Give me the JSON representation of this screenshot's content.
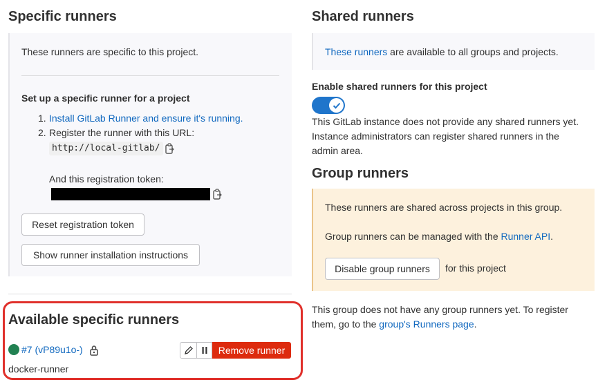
{
  "specific": {
    "title": "Specific runners",
    "intro": "These runners are specific to this project.",
    "setup_title": "Set up a specific runner for a project",
    "step1_num": "1.",
    "step1_link": "Install GitLab Runner and ensure it's running.",
    "step2_num": "2.",
    "step2_text": "Register the runner with this URL:",
    "url": "http://local-gitlab/",
    "token_label": "And this registration token:",
    "reset_button": "Reset registration token",
    "show_instructions_button": "Show runner installation instructions"
  },
  "available": {
    "title": "Available specific runners",
    "runner_link": "#7 (vP89u1o-)",
    "runner_description": "docker-runner",
    "remove_button": "Remove runner"
  },
  "shared": {
    "title": "Shared runners",
    "link": "These runners",
    "text_rest": " are available to all groups and projects.",
    "toggle_label": "Enable shared runners for this project",
    "toggle_on": true,
    "note_line1": "This GitLab instance does not provide any shared runners yet.",
    "note_line2": "Instance administrators can register shared runners in the",
    "note_line3": "admin area."
  },
  "group": {
    "title": "Group runners",
    "text1": "These runners are shared across projects in this group.",
    "text2_prefix": "Group runners can be managed with the ",
    "text2_link": "Runner API",
    "text2_suffix": ".",
    "disable_button": "Disable group runners",
    "disable_suffix": "for this project",
    "footer_line1": "This group does not have any group runners yet. To register",
    "footer_line2_prefix": "them, go to the ",
    "footer_line2_link": "group's Runners page",
    "footer_line2_suffix": "."
  },
  "colors": {
    "link": "#1068bf",
    "toggle": "#1f75cb",
    "danger": "#dd2b0e",
    "online": "#218152",
    "highlight": "#e0302b"
  }
}
